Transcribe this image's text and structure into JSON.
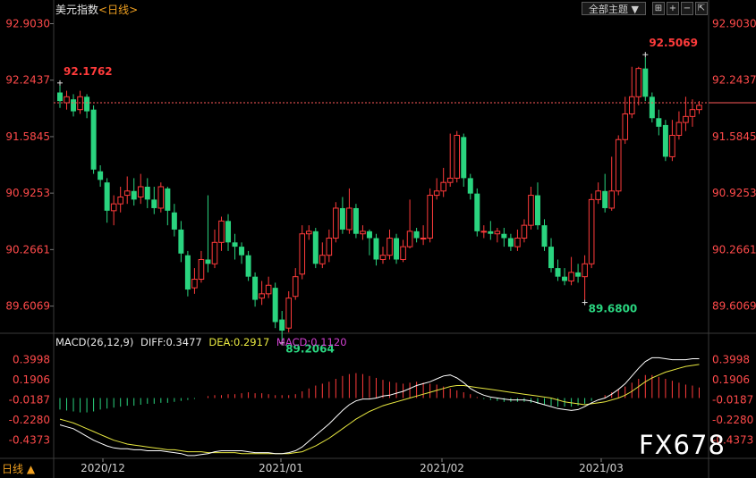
{
  "header": {
    "title": "美元指数",
    "period_label": "<日线>",
    "theme_button": "全部主题",
    "toolbar_icons": [
      "fit-icon",
      "zoom-in-icon",
      "zoom-out-icon",
      "expand-icon"
    ]
  },
  "colors": {
    "up": "#ff3b3b",
    "down": "#2ad47f",
    "price_axis": "#ff4a4a",
    "macd_axis": "#ff4a4a",
    "diff_line": "#ffffff",
    "dea_line": "#e8e840",
    "macd_label": "#d040d0",
    "grid": "#3a3a3a",
    "last_price_line": "#ff5a5a"
  },
  "price_axis": {
    "ticks": [
      "92.9030",
      "92.2437",
      "91.5845",
      "90.9253",
      "90.2661",
      "89.6069"
    ]
  },
  "macd_axis": {
    "ticks": [
      "0.3998",
      "0.1906",
      "-0.0187",
      "-0.2280",
      "-0.4373"
    ]
  },
  "macd_legend": {
    "name": "MACD(26,12,9)",
    "diff": "DIFF:0.3477",
    "dea": "DEA:0.2917",
    "macd": "MACD:0.1120"
  },
  "date_axis": {
    "labels": [
      "2020/12",
      "2021/01",
      "2021/02",
      "2021/03"
    ]
  },
  "annotations": {
    "high_left": "92.1762",
    "high_right": "92.5069",
    "low_left": "89.2064",
    "low_right": "89.6800"
  },
  "footer": {
    "period": "日线 ▲"
  },
  "watermark": "FX678",
  "chart_data": {
    "type": "candlestick",
    "ylim": [
      89.3,
      92.95
    ],
    "candles": [
      [
        92.1,
        92.0,
        92.18,
        91.92
      ],
      [
        91.98,
        92.05,
        92.12,
        91.9
      ],
      [
        92.02,
        91.88,
        92.08,
        91.82
      ],
      [
        91.9,
        92.05,
        92.12,
        91.85
      ],
      [
        92.05,
        91.88,
        92.08,
        91.8
      ],
      [
        91.9,
        91.2,
        91.95,
        91.15
      ],
      [
        91.18,
        91.08,
        91.25,
        91.0
      ],
      [
        91.05,
        90.72,
        91.1,
        90.58
      ],
      [
        90.72,
        90.8,
        90.9,
        90.55
      ],
      [
        90.8,
        90.88,
        91.0,
        90.7
      ],
      [
        90.9,
        90.95,
        91.12,
        90.8
      ],
      [
        90.95,
        90.85,
        91.1,
        90.78
      ],
      [
        90.88,
        91.0,
        91.15,
        90.8
      ],
      [
        91.0,
        90.85,
        91.1,
        90.75
      ],
      [
        90.85,
        90.75,
        91.0,
        90.68
      ],
      [
        90.75,
        91.0,
        91.05,
        90.7
      ],
      [
        90.98,
        90.72,
        91.0,
        90.55
      ],
      [
        90.7,
        90.5,
        90.8,
        90.42
      ],
      [
        90.5,
        90.22,
        90.6,
        90.12
      ],
      [
        90.2,
        89.8,
        90.25,
        89.72
      ],
      [
        89.82,
        89.92,
        90.05,
        89.75
      ],
      [
        89.92,
        90.15,
        90.25,
        89.88
      ],
      [
        90.15,
        90.1,
        90.9,
        90.0
      ],
      [
        90.1,
        90.35,
        90.5,
        90.05
      ],
      [
        90.35,
        90.6,
        90.65,
        90.25
      ],
      [
        90.6,
        90.35,
        90.68,
        90.25
      ],
      [
        90.35,
        90.3,
        90.45,
        90.15
      ],
      [
        90.3,
        90.2,
        90.35,
        90.1
      ],
      [
        90.2,
        89.95,
        90.25,
        89.9
      ],
      [
        89.95,
        89.68,
        90.0,
        89.6
      ],
      [
        89.7,
        89.75,
        89.9,
        89.62
      ],
      [
        89.75,
        89.85,
        89.95,
        89.7
      ],
      [
        89.82,
        89.42,
        89.88,
        89.35
      ],
      [
        89.45,
        89.32,
        89.55,
        89.21
      ],
      [
        89.35,
        89.7,
        89.78,
        89.3
      ],
      [
        89.72,
        89.95,
        90.05,
        89.68
      ],
      [
        89.98,
        90.45,
        90.55,
        89.92
      ],
      [
        90.45,
        90.48,
        90.55,
        90.38
      ],
      [
        90.48,
        90.1,
        90.52,
        90.05
      ],
      [
        90.1,
        90.2,
        90.35,
        90.05
      ],
      [
        90.2,
        90.4,
        90.5,
        90.12
      ],
      [
        90.4,
        90.75,
        90.82,
        90.35
      ],
      [
        90.75,
        90.5,
        90.88,
        90.45
      ],
      [
        90.5,
        90.75,
        90.98,
        90.45
      ],
      [
        90.75,
        90.45,
        90.8,
        90.4
      ],
      [
        90.45,
        90.48,
        90.55,
        90.38
      ],
      [
        90.48,
        90.4,
        90.5,
        90.2
      ],
      [
        90.4,
        90.15,
        90.45,
        90.08
      ],
      [
        90.15,
        90.2,
        90.3,
        90.1
      ],
      [
        90.2,
        90.4,
        90.5,
        90.15
      ],
      [
        90.4,
        90.15,
        90.45,
        90.1
      ],
      [
        90.15,
        90.3,
        90.38,
        90.12
      ],
      [
        90.3,
        90.48,
        90.85,
        90.28
      ],
      [
        90.48,
        90.4,
        90.52,
        90.35
      ],
      [
        90.4,
        90.4,
        90.55,
        90.32
      ],
      [
        90.4,
        90.9,
        90.98,
        90.35
      ],
      [
        90.9,
        90.95,
        91.1,
        90.85
      ],
      [
        90.95,
        91.05,
        91.22,
        90.88
      ],
      [
        91.05,
        91.1,
        91.62,
        91.0
      ],
      [
        91.1,
        91.6,
        91.65,
        91.05
      ],
      [
        91.58,
        91.1,
        91.62,
        91.0
      ],
      [
        91.1,
        90.92,
        91.15,
        90.85
      ],
      [
        90.92,
        90.48,
        90.98,
        90.42
      ],
      [
        90.48,
        90.48,
        90.55,
        90.4
      ],
      [
        90.48,
        90.45,
        90.6,
        90.38
      ],
      [
        90.45,
        90.48,
        90.52,
        90.35
      ],
      [
        90.45,
        90.4,
        90.52,
        90.3
      ],
      [
        90.4,
        90.3,
        90.45,
        90.25
      ],
      [
        90.3,
        90.4,
        90.5,
        90.25
      ],
      [
        90.4,
        90.55,
        90.62,
        90.35
      ],
      [
        90.55,
        90.9,
        91.0,
        90.5
      ],
      [
        90.9,
        90.55,
        91.05,
        90.5
      ],
      [
        90.55,
        90.3,
        90.62,
        90.25
      ],
      [
        90.3,
        90.05,
        90.4,
        90.0
      ],
      [
        90.05,
        89.95,
        90.15,
        89.9
      ],
      [
        89.95,
        89.9,
        90.05,
        89.85
      ],
      [
        89.9,
        90.0,
        90.18,
        89.85
      ],
      [
        90.0,
        89.95,
        90.1,
        89.88
      ],
      [
        89.95,
        90.1,
        90.2,
        89.68
      ],
      [
        90.1,
        90.85,
        90.92,
        90.05
      ],
      [
        90.85,
        90.95,
        91.05,
        90.8
      ],
      [
        90.95,
        90.75,
        91.15,
        90.7
      ],
      [
        90.75,
        90.95,
        91.35,
        90.72
      ],
      [
        90.95,
        91.55,
        91.6,
        90.9
      ],
      [
        91.55,
        91.85,
        92.05,
        91.5
      ],
      [
        91.85,
        92.05,
        92.4,
        91.8
      ],
      [
        92.05,
        92.38,
        92.4,
        91.95
      ],
      [
        92.38,
        92.05,
        92.51,
        92.0
      ],
      [
        92.05,
        91.8,
        92.1,
        91.75
      ],
      [
        91.8,
        91.7,
        91.9,
        91.6
      ],
      [
        91.72,
        91.35,
        91.78,
        91.3
      ],
      [
        91.35,
        91.6,
        91.78,
        91.3
      ],
      [
        91.6,
        91.75,
        91.88,
        91.55
      ],
      [
        91.75,
        91.82,
        92.05,
        91.65
      ],
      [
        91.82,
        91.9,
        92.02,
        91.7
      ],
      [
        91.9,
        91.95,
        92.0,
        91.85
      ]
    ],
    "last_price": 91.98,
    "macd": {
      "ylim": [
        -0.62,
        0.48
      ],
      "hist": [
        -0.12,
        -0.13,
        -0.14,
        -0.15,
        -0.15,
        -0.14,
        -0.12,
        -0.11,
        -0.1,
        -0.09,
        -0.08,
        -0.08,
        -0.07,
        -0.06,
        -0.06,
        -0.05,
        -0.05,
        -0.04,
        -0.03,
        -0.02,
        -0.01,
        0.0,
        0.02,
        0.03,
        0.03,
        0.04,
        0.04,
        0.05,
        0.06,
        0.05,
        0.05,
        0.04,
        0.03,
        0.03,
        0.03,
        0.04,
        0.07,
        0.1,
        0.13,
        0.15,
        0.17,
        0.2,
        0.23,
        0.25,
        0.26,
        0.25,
        0.23,
        0.21,
        0.19,
        0.17,
        0.16,
        0.15,
        0.16,
        0.17,
        0.16,
        0.15,
        0.14,
        0.12,
        0.1,
        0.08,
        0.06,
        0.04,
        0.01,
        -0.01,
        -0.02,
        -0.03,
        -0.04,
        -0.04,
        -0.04,
        -0.04,
        -0.05,
        -0.06,
        -0.07,
        -0.08,
        -0.09,
        -0.09,
        -0.09,
        -0.08,
        -0.06,
        -0.03,
        0.0,
        0.03,
        0.06,
        0.09,
        0.12,
        0.16,
        0.2,
        0.24,
        0.24,
        0.22,
        0.2,
        0.18,
        0.16,
        0.14,
        0.13,
        0.11
      ],
      "diff": [
        -0.28,
        -0.3,
        -0.32,
        -0.36,
        -0.4,
        -0.44,
        -0.47,
        -0.5,
        -0.52,
        -0.53,
        -0.53,
        -0.54,
        -0.54,
        -0.55,
        -0.55,
        -0.55,
        -0.56,
        -0.57,
        -0.58,
        -0.6,
        -0.6,
        -0.59,
        -0.58,
        -0.56,
        -0.55,
        -0.55,
        -0.55,
        -0.55,
        -0.56,
        -0.57,
        -0.57,
        -0.57,
        -0.58,
        -0.58,
        -0.57,
        -0.55,
        -0.51,
        -0.45,
        -0.39,
        -0.33,
        -0.27,
        -0.2,
        -0.13,
        -0.07,
        -0.03,
        -0.01,
        -0.01,
        0.0,
        0.02,
        0.03,
        0.05,
        0.07,
        0.1,
        0.13,
        0.15,
        0.17,
        0.2,
        0.23,
        0.24,
        0.21,
        0.16,
        0.1,
        0.06,
        0.03,
        0.01,
        0.0,
        -0.01,
        -0.02,
        -0.02,
        -0.02,
        -0.03,
        -0.05,
        -0.07,
        -0.09,
        -0.11,
        -0.12,
        -0.13,
        -0.12,
        -0.09,
        -0.05,
        -0.02,
        0.0,
        0.04,
        0.09,
        0.15,
        0.23,
        0.31,
        0.38,
        0.42,
        0.42,
        0.41,
        0.4,
        0.4,
        0.4,
        0.41,
        0.41
      ],
      "dea": [
        -0.22,
        -0.24,
        -0.26,
        -0.29,
        -0.32,
        -0.35,
        -0.38,
        -0.41,
        -0.44,
        -0.46,
        -0.48,
        -0.49,
        -0.5,
        -0.51,
        -0.52,
        -0.53,
        -0.54,
        -0.54,
        -0.55,
        -0.56,
        -0.56,
        -0.56,
        -0.57,
        -0.57,
        -0.57,
        -0.57,
        -0.57,
        -0.58,
        -0.58,
        -0.58,
        -0.58,
        -0.58,
        -0.58,
        -0.58,
        -0.58,
        -0.57,
        -0.56,
        -0.53,
        -0.5,
        -0.46,
        -0.42,
        -0.37,
        -0.32,
        -0.27,
        -0.22,
        -0.18,
        -0.14,
        -0.11,
        -0.08,
        -0.06,
        -0.04,
        -0.02,
        0.0,
        0.02,
        0.04,
        0.06,
        0.08,
        0.1,
        0.12,
        0.13,
        0.13,
        0.12,
        0.11,
        0.1,
        0.09,
        0.08,
        0.07,
        0.06,
        0.05,
        0.04,
        0.03,
        0.02,
        0.01,
        0.0,
        -0.02,
        -0.04,
        -0.05,
        -0.06,
        -0.07,
        -0.06,
        -0.05,
        -0.04,
        -0.02,
        0.0,
        0.03,
        0.07,
        0.12,
        0.17,
        0.21,
        0.24,
        0.27,
        0.29,
        0.31,
        0.33,
        0.34,
        0.35
      ]
    }
  }
}
